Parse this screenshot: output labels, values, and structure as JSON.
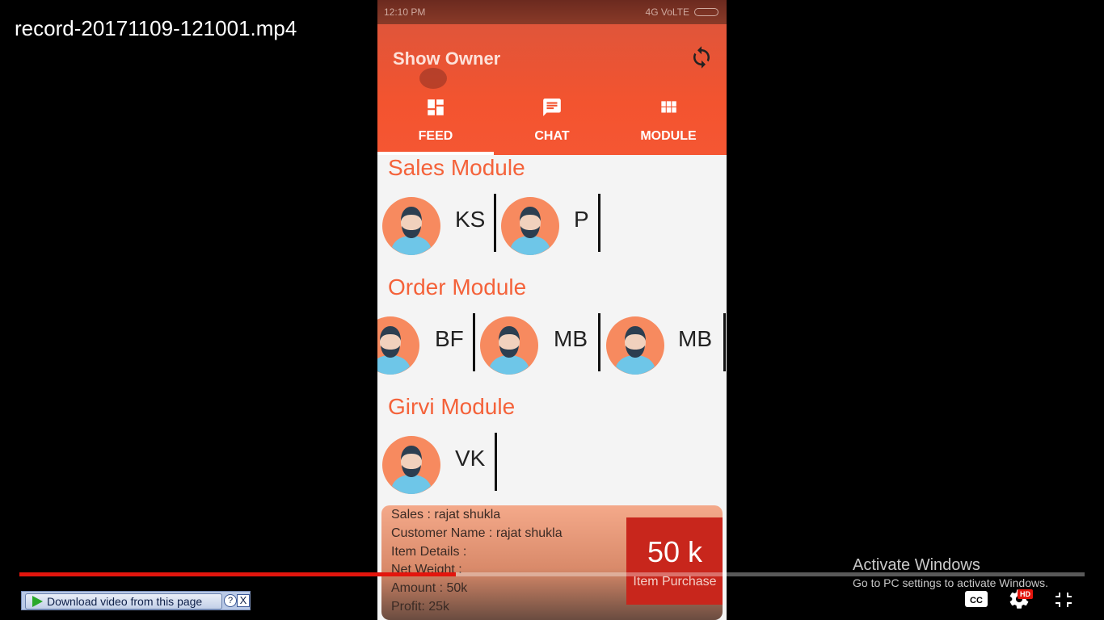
{
  "video": {
    "filename": "record-20171109-121001.mp4",
    "progress_percent": 41
  },
  "statusbar": {
    "time": "12:10 PM",
    "network": "4G VoLTE"
  },
  "app": {
    "title": "Show Owner",
    "tabs": [
      {
        "label": "FEED",
        "icon": "dashboard-icon",
        "active": true
      },
      {
        "label": "CHAT",
        "icon": "chat-icon",
        "active": false
      },
      {
        "label": "MODULE",
        "icon": "grid-icon",
        "active": false
      }
    ],
    "modules": [
      {
        "title": "Sales Module",
        "users": [
          "KS",
          "P"
        ]
      },
      {
        "title": "Order Module",
        "users": [
          "BF",
          "MB",
          "MB"
        ]
      },
      {
        "title": "Girvi Module",
        "users": [
          "VK"
        ]
      }
    ],
    "card": {
      "lines": [
        "Sales : rajat shukla",
        "Customer Name : rajat shukla",
        "Item Details :",
        "Net Weight :",
        "Amount : 50k",
        "Profit: 25k"
      ],
      "amount": "50 k",
      "amount_label": "Item Purchase"
    }
  },
  "overlay": {
    "download_label": "Download video from this page",
    "help_label": "?",
    "close_label": "X",
    "activate_title": "Activate Windows",
    "activate_subtitle": "Go to PC settings to activate Windows.",
    "hd_label": "HD"
  },
  "colors": {
    "accent": "#f3542f",
    "module_title": "#f4623a",
    "progress": "#e3150d"
  }
}
